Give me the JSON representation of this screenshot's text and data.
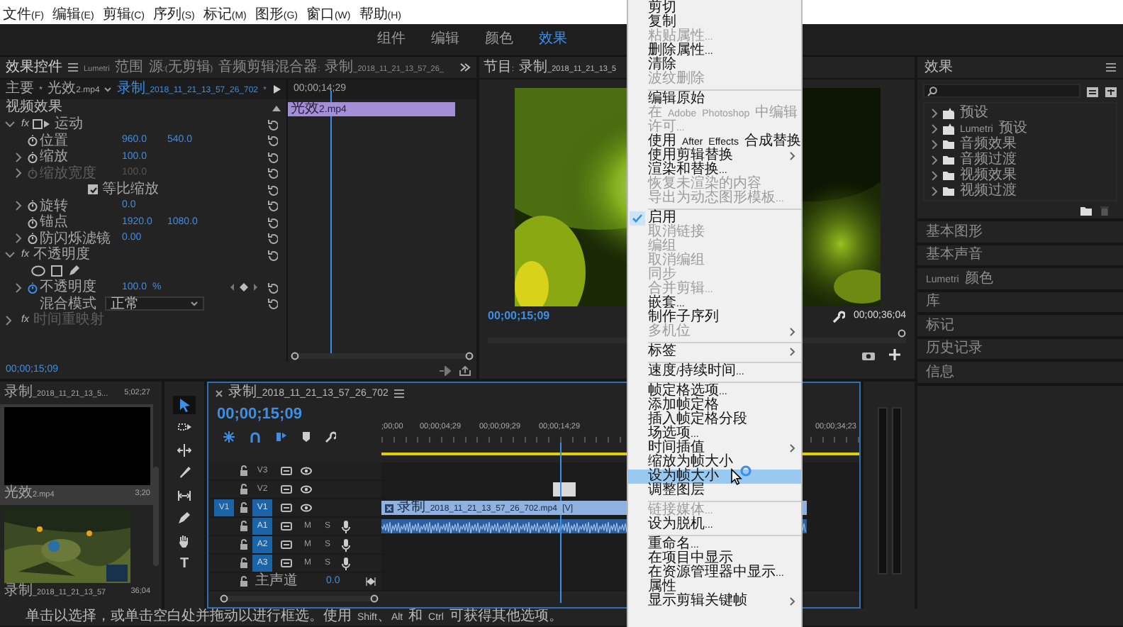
{
  "menu_bar": [
    "文件(F)",
    "编辑(E)",
    "剪辑(C)",
    "序列(S)",
    "标记(M)",
    "图形(G)",
    "窗口(W)",
    "帮助(H)"
  ],
  "workspaces": [
    {
      "label": "组件",
      "selected": false
    },
    {
      "label": "编辑",
      "selected": false
    },
    {
      "label": "颜色",
      "selected": false
    },
    {
      "label": "效果",
      "selected": true
    }
  ],
  "effect_controls": {
    "tabs": [
      {
        "label": "效果控件",
        "selected": true
      },
      {
        "label": "Lumetri 范围",
        "selected": false
      },
      {
        "label": "源:(无剪辑)",
        "selected": false
      },
      {
        "label": "音频剪辑混合器: 录制_2018_11_21_13_57_26_",
        "selected": false
      }
    ],
    "master_clip": "主要 * 光效2.mp4",
    "sequence_clip": "录制_2018_11_21_13_57_26_702 *",
    "mini_time": "00;00;14;29",
    "mini_clip": "光效2.mp4",
    "section": "视频效果",
    "rows": [
      {
        "kind": "group",
        "badge": "fx",
        "label": "运动",
        "expanded": true,
        "disabled": false,
        "handle_icon": true
      },
      {
        "kind": "param",
        "label": "位置",
        "values": [
          "960.0",
          "540.0"
        ],
        "expandable": false,
        "disabled": false,
        "animated": false
      },
      {
        "kind": "param",
        "label": "缩放",
        "values": [
          "100.0"
        ],
        "expandable": true,
        "disabled": false,
        "animated": false
      },
      {
        "kind": "param",
        "label": "缩放宽度",
        "values": [
          "100.0"
        ],
        "expandable": true,
        "disabled": true,
        "animated": false
      },
      {
        "kind": "check",
        "label": "等比缩放",
        "checked": true
      },
      {
        "kind": "param",
        "label": "旋转",
        "values": [
          "0.0"
        ],
        "expandable": true,
        "disabled": false,
        "animated": false
      },
      {
        "kind": "param",
        "label": "锚点",
        "values": [
          "1920.0",
          "1080.0"
        ],
        "expandable": false,
        "disabled": false,
        "animated": false
      },
      {
        "kind": "param",
        "label": "防闪烁滤镜",
        "values": [
          "0.00"
        ],
        "expandable": true,
        "disabled": false,
        "animated": false
      },
      {
        "kind": "group",
        "badge": "fx",
        "label": "不透明度",
        "expanded": true,
        "disabled": false,
        "handle_icon": false
      },
      {
        "kind": "masks"
      },
      {
        "kind": "param",
        "label": "不透明度",
        "values": [
          "100.0 %"
        ],
        "expandable": true,
        "disabled": false,
        "animated": true
      },
      {
        "kind": "select",
        "label": "混合模式",
        "value": "正常"
      },
      {
        "kind": "group",
        "badge": "fx",
        "label": "时间重映射",
        "expanded": false,
        "disabled": true,
        "handle_icon": false
      }
    ],
    "timecode": "00;00;15;09"
  },
  "program_monitor": {
    "title": "节目: 录制_2018_11_21_13_5",
    "timecode": "00;00;15;09",
    "duration": "00;00;36;04"
  },
  "effects_panel": {
    "title": "效果",
    "tree": [
      {
        "label": "预设",
        "kind": "preset"
      },
      {
        "label": "Lumetri 预设",
        "kind": "preset"
      },
      {
        "label": "音频效果",
        "kind": "folder"
      },
      {
        "label": "音频过渡",
        "kind": "folder"
      },
      {
        "label": "视频效果",
        "kind": "folder"
      },
      {
        "label": "视频过渡",
        "kind": "folder"
      }
    ]
  },
  "side_panels": [
    "基本图形",
    "基本声音",
    "Lumetri 颜色",
    "库",
    "标记",
    "历史记录",
    "信息"
  ],
  "project": {
    "items": [
      {
        "name": "录制_2018_11_21_13_5...",
        "duration": "5;02;27",
        "kind": "label",
        "selected": false
      },
      {
        "name": "光效2.mp4",
        "duration": "3;20",
        "kind": "blackframe",
        "selected": true
      },
      {
        "name": "录制_2018_11_21_13_57",
        "duration": "36;04",
        "kind": "picture",
        "selected": false
      }
    ]
  },
  "tools": [
    {
      "kind": "select",
      "selected": true
    },
    {
      "kind": "track_select",
      "selected": false
    },
    {
      "kind": "ripple",
      "selected": false
    },
    {
      "kind": "razor",
      "selected": false
    },
    {
      "kind": "slip",
      "selected": false
    },
    {
      "kind": "pen",
      "selected": false
    },
    {
      "kind": "hand",
      "selected": false
    },
    {
      "kind": "type",
      "glyph": "T",
      "selected": false
    }
  ],
  "timeline": {
    "title": "录制_2018_11_21_13_57_26_702",
    "timecode": "00;00;15;09",
    "ruler": [
      ";00;00",
      "00;00;04;29",
      "00;00;09;29",
      "00;00;14;29",
      "00;00;34;23"
    ],
    "tracks": [
      {
        "name": "V3",
        "kind": "video",
        "targeted": false
      },
      {
        "name": "V2",
        "kind": "video",
        "targeted": false,
        "clip": {
          "kind": "stub"
        }
      },
      {
        "name": "V1",
        "kind": "video",
        "targeted": true,
        "source_patch": "V1",
        "clip": {
          "kind": "video",
          "label": "录制_2018_11_21_13_57_26_702.mp4 [V]"
        }
      },
      {
        "name": "A1",
        "kind": "audio",
        "targeted": true,
        "buttons": [
          "M",
          "S"
        ],
        "clip": {
          "kind": "audio"
        }
      },
      {
        "name": "A2",
        "kind": "audio",
        "targeted": true,
        "buttons": [
          "M",
          "S"
        ]
      },
      {
        "name": "A3",
        "kind": "audio",
        "targeted": true,
        "buttons": [
          "M",
          "S"
        ]
      },
      {
        "name": "主声道",
        "kind": "master",
        "value": "0.0"
      }
    ]
  },
  "context_menu": {
    "items": [
      {
        "label": "剪切",
        "disabled": false,
        "checked": false,
        "submenu": false,
        "selected": false,
        "separator_before": false
      },
      {
        "label": "复制",
        "disabled": false,
        "checked": false,
        "submenu": false,
        "selected": false,
        "separator_before": false
      },
      {
        "label": "粘贴属性...",
        "disabled": true,
        "checked": false,
        "submenu": false,
        "selected": false,
        "separator_before": false
      },
      {
        "label": "删除属性...",
        "disabled": false,
        "checked": false,
        "submenu": false,
        "selected": false,
        "separator_before": false
      },
      {
        "label": "清除",
        "disabled": false,
        "checked": false,
        "submenu": false,
        "selected": false,
        "separator_before": false
      },
      {
        "label": "波纹删除",
        "disabled": true,
        "checked": false,
        "submenu": false,
        "selected": false,
        "separator_before": false
      },
      {
        "label": "编辑原始",
        "disabled": false,
        "checked": false,
        "submenu": false,
        "selected": false,
        "separator_before": true
      },
      {
        "label": "在 Adobe Photoshop 中编辑",
        "disabled": true,
        "checked": false,
        "submenu": false,
        "selected": false,
        "separator_before": false
      },
      {
        "label": "许可...",
        "disabled": true,
        "checked": false,
        "submenu": false,
        "selected": false,
        "separator_before": false
      },
      {
        "label": "使用 After Effects 合成替换",
        "disabled": false,
        "checked": false,
        "submenu": false,
        "selected": false,
        "separator_before": false
      },
      {
        "label": "使用剪辑替换",
        "disabled": false,
        "checked": false,
        "submenu": true,
        "selected": false,
        "separator_before": false
      },
      {
        "label": "渲染和替换...",
        "disabled": false,
        "checked": false,
        "submenu": false,
        "selected": false,
        "separator_before": false
      },
      {
        "label": "恢复未渲染的内容",
        "disabled": true,
        "checked": false,
        "submenu": false,
        "selected": false,
        "separator_before": false
      },
      {
        "label": "导出为动态图形模板...",
        "disabled": true,
        "checked": false,
        "submenu": false,
        "selected": false,
        "separator_before": false
      },
      {
        "label": "启用",
        "disabled": false,
        "checked": true,
        "submenu": false,
        "selected": false,
        "separator_before": true
      },
      {
        "label": "取消链接",
        "disabled": true,
        "checked": false,
        "submenu": false,
        "selected": false,
        "separator_before": false
      },
      {
        "label": "编组",
        "disabled": true,
        "checked": false,
        "submenu": false,
        "selected": false,
        "separator_before": false
      },
      {
        "label": "取消编组",
        "disabled": true,
        "checked": false,
        "submenu": false,
        "selected": false,
        "separator_before": false
      },
      {
        "label": "同步",
        "disabled": true,
        "checked": false,
        "submenu": false,
        "selected": false,
        "separator_before": false
      },
      {
        "label": "合并剪辑...",
        "disabled": true,
        "checked": false,
        "submenu": false,
        "selected": false,
        "separator_before": false
      },
      {
        "label": "嵌套...",
        "disabled": false,
        "checked": false,
        "submenu": false,
        "selected": false,
        "separator_before": false
      },
      {
        "label": "制作子序列",
        "disabled": false,
        "checked": false,
        "submenu": false,
        "selected": false,
        "separator_before": false
      },
      {
        "label": "多机位",
        "disabled": true,
        "checked": false,
        "submenu": true,
        "selected": false,
        "separator_before": false
      },
      {
        "label": "标签",
        "disabled": false,
        "checked": false,
        "submenu": true,
        "selected": false,
        "separator_before": true
      },
      {
        "label": "速度/持续时间...",
        "disabled": false,
        "checked": false,
        "submenu": false,
        "selected": false,
        "separator_before": true
      },
      {
        "label": "帧定格选项...",
        "disabled": false,
        "checked": false,
        "submenu": false,
        "selected": false,
        "separator_before": true
      },
      {
        "label": "添加帧定格",
        "disabled": false,
        "checked": false,
        "submenu": false,
        "selected": false,
        "separator_before": false
      },
      {
        "label": "插入帧定格分段",
        "disabled": false,
        "checked": false,
        "submenu": false,
        "selected": false,
        "separator_before": false
      },
      {
        "label": "场选项...",
        "disabled": false,
        "checked": false,
        "submenu": false,
        "selected": false,
        "separator_before": false
      },
      {
        "label": "时间插值",
        "disabled": false,
        "checked": false,
        "submenu": true,
        "selected": false,
        "separator_before": false
      },
      {
        "label": "缩放为帧大小",
        "disabled": false,
        "checked": false,
        "submenu": false,
        "selected": false,
        "separator_before": false
      },
      {
        "label": "设为帧大小",
        "disabled": false,
        "checked": false,
        "submenu": false,
        "selected": true,
        "separator_before": false
      },
      {
        "label": "调整图层",
        "disabled": false,
        "checked": false,
        "submenu": false,
        "selected": false,
        "separator_before": false
      },
      {
        "label": "链接媒体...",
        "disabled": true,
        "checked": false,
        "submenu": false,
        "selected": false,
        "separator_before": true
      },
      {
        "label": "设为脱机...",
        "disabled": false,
        "checked": false,
        "submenu": false,
        "selected": false,
        "separator_before": false
      },
      {
        "label": "重命名...",
        "disabled": false,
        "checked": false,
        "submenu": false,
        "selected": false,
        "separator_before": true
      },
      {
        "label": "在项目中显示",
        "disabled": false,
        "checked": false,
        "submenu": false,
        "selected": false,
        "separator_before": false
      },
      {
        "label": "在资源管理器中显示...",
        "disabled": false,
        "checked": false,
        "submenu": false,
        "selected": false,
        "separator_before": false
      },
      {
        "label": "属性",
        "disabled": false,
        "checked": false,
        "submenu": false,
        "selected": false,
        "separator_before": false
      },
      {
        "label": "显示剪辑关键帧",
        "disabled": false,
        "checked": false,
        "submenu": true,
        "selected": false,
        "separator_before": false
      }
    ]
  },
  "status_bar": "单击以选择，或单击空白处并拖动以进行框选。使用 Shift、Alt 和 Ctrl 可获得其他选项。"
}
